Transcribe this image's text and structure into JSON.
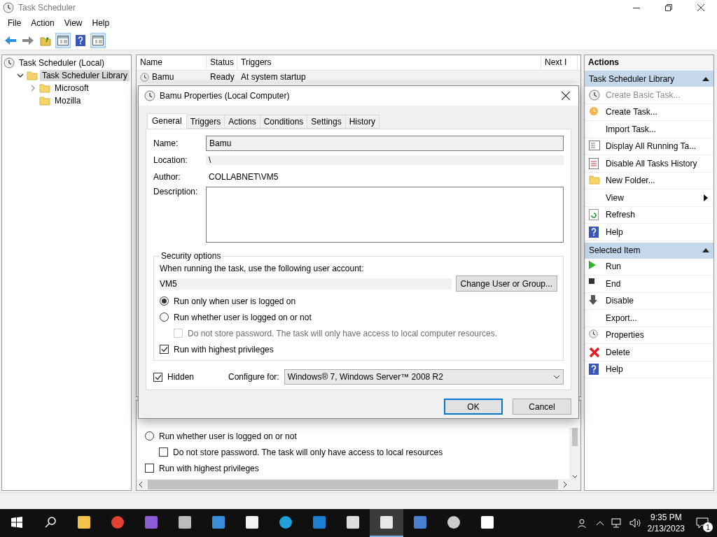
{
  "window": {
    "title": "Task Scheduler"
  },
  "menu": [
    "File",
    "Action",
    "View",
    "Help"
  ],
  "toolbar": [
    {
      "kind": "back",
      "pressed": false
    },
    {
      "kind": "forward",
      "pressed": false
    },
    {
      "kind": "folder",
      "pressed": false
    },
    {
      "kind": "pane",
      "pressed": true
    },
    {
      "kind": "help",
      "pressed": false
    },
    {
      "kind": "pane",
      "pressed": true
    }
  ],
  "tree": [
    {
      "label": "Task Scheduler (Local)",
      "selected": false,
      "children": [
        {
          "label": "Task Scheduler Library",
          "selected": true,
          "expanded": true,
          "children": [
            {
              "label": "Microsoft",
              "selected": false,
              "expanded": false
            },
            {
              "label": "Mozilla",
              "selected": false
            }
          ]
        }
      ]
    }
  ],
  "task_list": {
    "columns": [
      "Name",
      "Status",
      "Triggers",
      "Next I"
    ],
    "rows": [
      {
        "cells": [
          "Bamu",
          "Ready",
          "At system startup"
        ]
      }
    ]
  },
  "detail_pane": {
    "options": [
      {
        "kind": "radio",
        "label": "Run whether user is logged on or not",
        "checked": false,
        "children": [
          {
            "kind": "checkbox",
            "label": "Do not store password.  The task will only have access to local resources",
            "checked": false
          }
        ]
      },
      {
        "kind": "checkbox",
        "label": "Run with highest privileges",
        "checked": false
      }
    ]
  },
  "actions": {
    "title": "Actions",
    "sections": [
      {
        "title": "Task Scheduler Library",
        "expanded": true,
        "items": [
          {
            "label": "Create Basic Task...",
            "disabled": true
          },
          {
            "label": "Create Task...",
            "disabled": false
          },
          {
            "label": "Import Task...",
            "disabled": false
          },
          {
            "label": "Display All Running Ta...",
            "disabled": false
          },
          {
            "label": "Disable All Tasks History",
            "disabled": false
          },
          {
            "label": "New Folder...",
            "disabled": false
          },
          {
            "label": "View",
            "disabled": false,
            "submenu": true
          },
          {
            "label": "Refresh",
            "disabled": false
          },
          {
            "label": "Help",
            "disabled": false
          }
        ]
      },
      {
        "title": "Selected Item",
        "expanded": true,
        "items": [
          {
            "label": "Run",
            "disabled": false
          },
          {
            "label": "End",
            "disabled": false
          },
          {
            "label": "Disable",
            "disabled": false
          },
          {
            "label": "Export...",
            "disabled": false
          },
          {
            "label": "Properties",
            "disabled": false
          },
          {
            "label": "Delete",
            "disabled": false
          },
          {
            "label": "Help",
            "disabled": false
          }
        ]
      }
    ]
  },
  "dialog": {
    "title": "Bamu Properties (Local Computer)",
    "tabs": [
      {
        "label": "General",
        "selected": true
      },
      {
        "label": "Triggers",
        "selected": false
      },
      {
        "label": "Actions",
        "selected": false
      },
      {
        "label": "Conditions",
        "selected": false
      },
      {
        "label": "Settings",
        "selected": false
      },
      {
        "label": "History",
        "selected": false
      }
    ],
    "name": {
      "label": "Name:",
      "value": "Bamu"
    },
    "location": {
      "label": "Location:",
      "value": "\\"
    },
    "author": {
      "label": "Author:",
      "value": "COLLABNET\\VM5"
    },
    "description": {
      "label": "Description:"
    },
    "security": {
      "title": "Security options",
      "account_label": "When running the task, use the following user account:",
      "account": "VM5",
      "change_button": "Change User or Group...",
      "options": [
        {
          "kind": "radio",
          "label": "Run only when user is logged on",
          "checked": true,
          "disabled": false
        },
        {
          "kind": "radio",
          "label": "Run whether user is logged on or not",
          "checked": false,
          "disabled": false,
          "children": [
            {
              "kind": "checkbox",
              "label": "Do not store password.  The task will only have access to local computer resources.",
              "checked": false,
              "disabled": true
            }
          ]
        },
        {
          "kind": "checkbox",
          "label": "Run with highest privileges",
          "checked": true,
          "disabled": false
        }
      ]
    },
    "hidden": {
      "label": "Hidden",
      "checked": true
    },
    "configure_for": {
      "label": "Configure for:",
      "value": "Windows® 7, Windows Server™ 2008 R2"
    },
    "buttons": [
      {
        "label": "OK",
        "default": true
      },
      {
        "label": "Cancel",
        "default": false
      }
    ]
  },
  "taskbar": {
    "apps": [
      {
        "selected": false
      },
      {
        "selected": false
      },
      {
        "selected": false
      },
      {
        "selected": false
      },
      {
        "selected": false
      },
      {
        "selected": false
      },
      {
        "selected": false
      },
      {
        "selected": false
      },
      {
        "selected": false
      },
      {
        "selected": true
      },
      {
        "selected": false
      },
      {
        "selected": false
      },
      {
        "selected": false
      }
    ],
    "time": "9:35 PM",
    "date": "2/13/2023",
    "notification_count": "1"
  }
}
